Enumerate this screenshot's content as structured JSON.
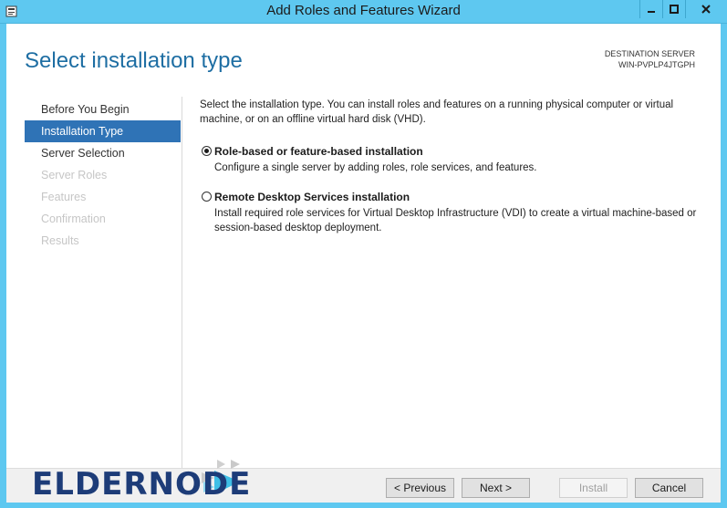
{
  "window": {
    "title": "Add Roles and Features Wizard"
  },
  "header": {
    "page_title": "Select installation type",
    "destination_label": "DESTINATION SERVER",
    "destination_server": "WIN-PVPLP4JTGPH"
  },
  "nav": {
    "items": [
      {
        "label": "Before You Begin",
        "state": "normal"
      },
      {
        "label": "Installation Type",
        "state": "active"
      },
      {
        "label": "Server Selection",
        "state": "normal"
      },
      {
        "label": "Server Roles",
        "state": "disabled"
      },
      {
        "label": "Features",
        "state": "disabled"
      },
      {
        "label": "Confirmation",
        "state": "disabled"
      },
      {
        "label": "Results",
        "state": "disabled"
      }
    ]
  },
  "main": {
    "intro": "Select the installation type. You can install roles and features on a running physical computer or virtual machine, or on an offline virtual hard disk (VHD).",
    "options": [
      {
        "label": "Role-based or feature-based installation",
        "description": "Configure a single server by adding roles, role services, and features.",
        "checked": true
      },
      {
        "label": "Remote Desktop Services installation",
        "description": "Install required role services for Virtual Desktop Infrastructure (VDI) to create a virtual machine-based or session-based desktop deployment.",
        "checked": false
      }
    ]
  },
  "buttons": {
    "previous": "< Previous",
    "next": "Next >",
    "install": "Install",
    "cancel": "Cancel"
  },
  "watermark": {
    "logo_text": "eldernode"
  },
  "colors": {
    "titlebar": "#5ec8f0",
    "accent": "#2f73b6",
    "page_title": "#1e6ea3",
    "logo_blue": "#1d3c78",
    "logo_cyan": "#3fbfe6"
  }
}
